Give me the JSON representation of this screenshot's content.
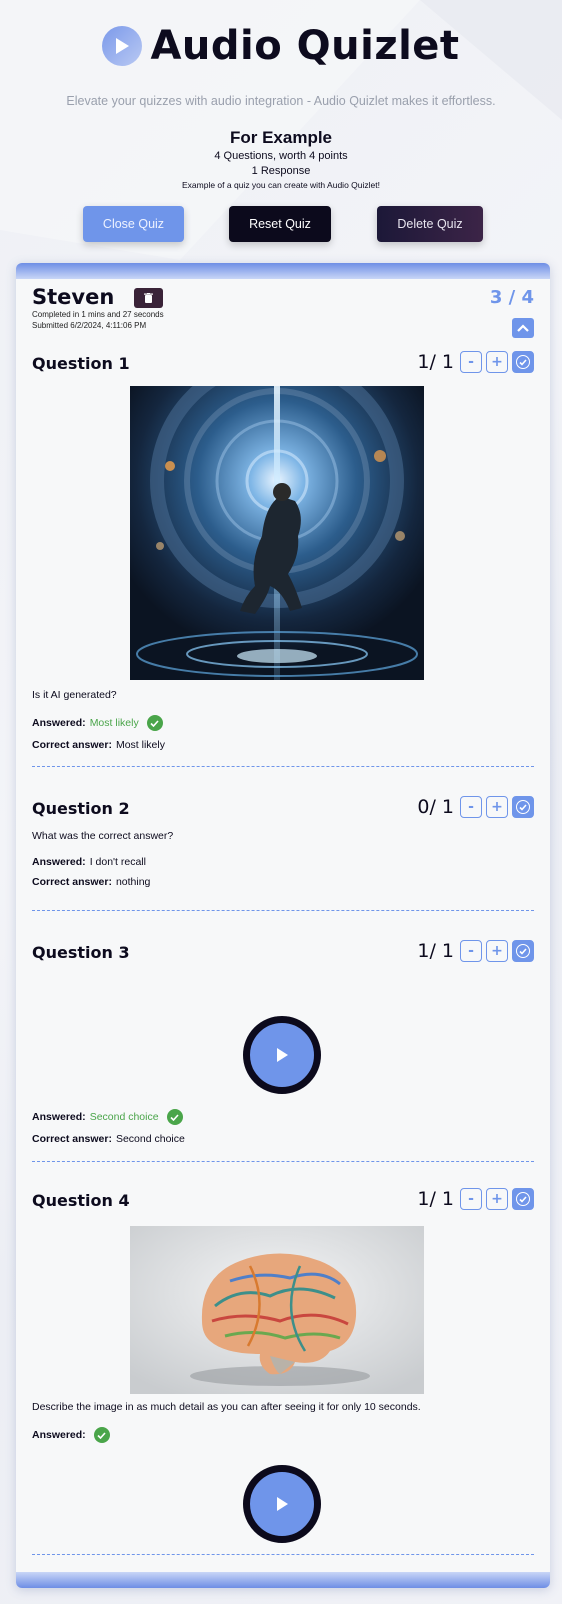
{
  "app": {
    "title": "Audio Quizlet",
    "tagline": "Elevate your quizzes with audio integration - Audio Quizlet makes it effortless."
  },
  "quiz": {
    "title": "For Example",
    "meta": "4 Questions, worth 4 points",
    "responses": "1 Response",
    "description": "Example of a quiz you can create with Audio Quizlet!"
  },
  "actions": {
    "close_label": "Close Quiz",
    "reset_label": "Reset Quiz",
    "delete_label": "Delete Quiz"
  },
  "response": {
    "name": "Steven",
    "completed": "Completed in 1 mins and 27 seconds",
    "submitted": "Submitted 6/2/2024, 4:11:06 PM",
    "score": "3 / 4"
  },
  "labels": {
    "answered": "Answered:",
    "correct_answer": "Correct answer:",
    "minus": "-",
    "plus": "+"
  },
  "questions": [
    {
      "title": "Question 1",
      "points": "1/ 1",
      "text": "Is it AI generated?",
      "answered": "Most likely",
      "correct_answer": "Most likely",
      "image": "ai-generated-person-in-vortex-image"
    },
    {
      "title": "Question 2",
      "points": "0/ 1",
      "text": "What was the correct answer?",
      "answered": "I don't recall",
      "correct_answer": "nothing"
    },
    {
      "title": "Question 3",
      "points": "1/ 1",
      "answered": "Second choice",
      "correct_answer": "Second choice"
    },
    {
      "title": "Question 4",
      "points": "1/ 1",
      "text": "Describe the image in as much detail as you can after seeing it for only 10 seconds.",
      "image": "colorful-circuit-brain-image"
    }
  ],
  "colors": {
    "accent": "#6f95ea",
    "dark": "#0c0a1c",
    "correct": "#4aa54a"
  }
}
